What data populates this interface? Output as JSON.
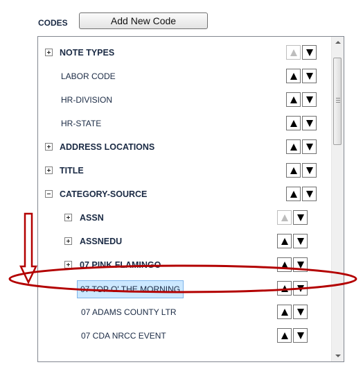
{
  "header": {
    "codes_label": "CODES",
    "add_button_label": "Add New Code"
  },
  "tree": {
    "items": [
      {
        "label": "NOTE TYPES",
        "level": 0,
        "expander": "plus",
        "bold": true,
        "up_enabled": false,
        "down_enabled": true,
        "selected": false
      },
      {
        "label": "LABOR CODE",
        "level": 0,
        "expander": "none",
        "bold": false,
        "up_enabled": true,
        "down_enabled": true,
        "selected": false
      },
      {
        "label": "HR-DIVISION",
        "level": 0,
        "expander": "none",
        "bold": false,
        "up_enabled": true,
        "down_enabled": true,
        "selected": false
      },
      {
        "label": "HR-STATE",
        "level": 0,
        "expander": "none",
        "bold": false,
        "up_enabled": true,
        "down_enabled": true,
        "selected": false
      },
      {
        "label": "ADDRESS LOCATIONS",
        "level": 0,
        "expander": "plus",
        "bold": true,
        "up_enabled": true,
        "down_enabled": true,
        "selected": false
      },
      {
        "label": "TITLE",
        "level": 0,
        "expander": "plus",
        "bold": true,
        "up_enabled": true,
        "down_enabled": true,
        "selected": false
      },
      {
        "label": "CATEGORY-SOURCE",
        "level": 0,
        "expander": "minus",
        "bold": true,
        "up_enabled": true,
        "down_enabled": true,
        "selected": false
      },
      {
        "label": "ASSN",
        "level": 1,
        "expander": "plus",
        "bold": true,
        "up_enabled": false,
        "down_enabled": true,
        "selected": false
      },
      {
        "label": "ASSNEDU",
        "level": 1,
        "expander": "plus",
        "bold": true,
        "up_enabled": true,
        "down_enabled": true,
        "selected": false
      },
      {
        "label": "07 PINK FLAMINGO",
        "level": 1,
        "expander": "plus",
        "bold": true,
        "up_enabled": true,
        "down_enabled": true,
        "selected": false
      },
      {
        "label": "07 TOP O' THE MORNING",
        "level": 1,
        "expander": "none",
        "bold": false,
        "up_enabled": true,
        "down_enabled": true,
        "selected": true
      },
      {
        "label": "07 ADAMS COUNTY LTR",
        "level": 1,
        "expander": "none",
        "bold": false,
        "up_enabled": true,
        "down_enabled": true,
        "selected": false
      },
      {
        "label": "07 CDA NRCC EVENT",
        "level": 1,
        "expander": "none",
        "bold": false,
        "up_enabled": true,
        "down_enabled": true,
        "selected": false
      }
    ]
  },
  "colors": {
    "annotation": "#b30000",
    "selection_bg": "#cce8ff",
    "selection_border": "#7eb4ea"
  },
  "icons": {
    "expand": "plus-box-icon",
    "collapse": "minus-box-icon",
    "move_up": "triangle-up-icon",
    "move_down": "triangle-down-icon"
  }
}
